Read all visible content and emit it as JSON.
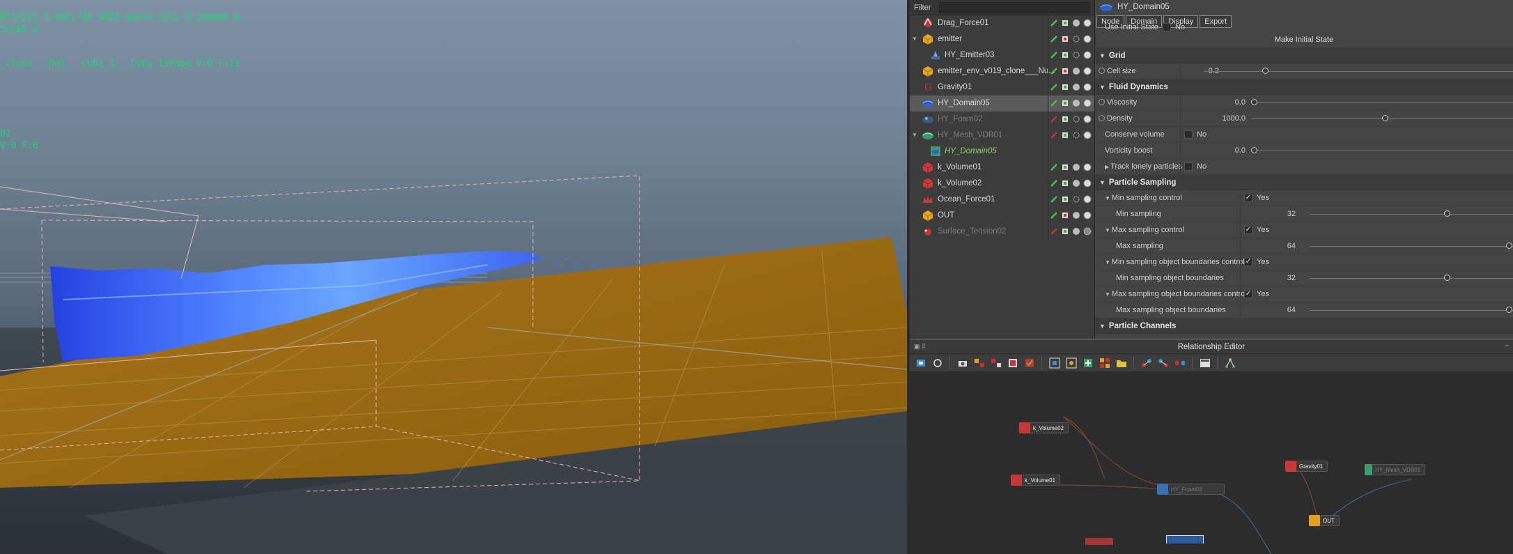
{
  "viewport": {
    "hud_lines": [
      "RTICLES 1,666,745 GRID 0x0x0 CELL 0.200000 m",
      "ICLES 0",
      "_clone___Nul___Cube_1___Cube_1Shape V:0 F:12",
      "02",
      " V:0 F:0"
    ]
  },
  "outliner": {
    "filter_label": "Filter",
    "filter_placeholder": "",
    "items": [
      {
        "label": "Drag_Force01",
        "muted": false
      },
      {
        "label": "emitter",
        "muted": false
      },
      {
        "label": "HY_Emitter03",
        "muted": false
      },
      {
        "label": "emitter_env_v019_clone___Nu...",
        "muted": false
      },
      {
        "label": "Gravity01",
        "muted": false
      },
      {
        "label": "HY_Domain05",
        "muted": false
      },
      {
        "label": "HY_Foam02",
        "muted": true
      },
      {
        "label": "HY_Mesh_VDB01",
        "muted": true
      },
      {
        "label": "HY_Domain05",
        "muted": false
      },
      {
        "label": "k_Volume01",
        "muted": false
      },
      {
        "label": "k_Volume02",
        "muted": false
      },
      {
        "label": "Ocean_Force01",
        "muted": false
      },
      {
        "label": "OUT",
        "muted": false
      },
      {
        "label": "Surface_Tension02",
        "muted": true
      }
    ]
  },
  "attribute_editor": {
    "node_name": "HY_Domain05",
    "tabs": [
      "Node",
      "Domain",
      "Display",
      "Export"
    ],
    "use_initial_state": {
      "label": "Use Initial State",
      "value": "No"
    },
    "make_initial_state": "Make Initial State",
    "sections": {
      "grid": "Grid",
      "fluid_dynamics": "Fluid Dynamics",
      "particle_sampling": "Particle Sampling",
      "particle_channels": "Particle Channels"
    },
    "cell_size": {
      "label": "Cell size",
      "value": "0.2",
      "fraction": 0.19
    },
    "viscosity": {
      "label": "Viscosity",
      "value": "0.0",
      "fraction": 0.0
    },
    "density": {
      "label": "Density",
      "value": "1000.0",
      "fraction": 0.5
    },
    "conserve_volume": {
      "label": "Conserve volume",
      "value": "No"
    },
    "vorticity_boost": {
      "label": "Vorticity boost",
      "value": "0.0",
      "fraction": 0.0
    },
    "track_lonely": {
      "label": "Track lonely particles",
      "value": "No"
    },
    "min_sampling_control": {
      "label": "Min sampling control",
      "value": "Yes"
    },
    "min_sampling": {
      "label": "Min sampling",
      "value": "32",
      "fraction": 0.66
    },
    "max_sampling_control": {
      "label": "Max sampling control",
      "value": "Yes"
    },
    "max_sampling": {
      "label": "Max sampling",
      "value": "64",
      "fraction": 1.0
    },
    "min_obj_control": {
      "label": "Min sampling object boundaries control",
      "value": "Yes"
    },
    "min_obj": {
      "label": "Min sampling object boundaries",
      "value": "32",
      "fraction": 0.66
    },
    "max_obj_control": {
      "label": "Max sampling object boundaries control",
      "value": "Yes"
    },
    "max_obj": {
      "label": "Max sampling object boundaries",
      "value": "64",
      "fraction": 1.0
    }
  },
  "relationship_editor": {
    "title": "Relationship Editor",
    "nodes": [
      {
        "id": "k_vol02",
        "label": "k_Volume02",
        "color": "#c8383a",
        "muted": false
      },
      {
        "id": "k_vol01",
        "label": "k_Volume01",
        "color": "#c8383a",
        "muted": false
      },
      {
        "id": "foam",
        "label": "HY_Foam02",
        "color": "#3a6fb0",
        "muted": true
      },
      {
        "id": "gravity",
        "label": "Gravity01",
        "color": "#c8383a",
        "muted": false
      },
      {
        "id": "mesh",
        "label": "HY_Mesh_VDB01",
        "color": "#3aa06a",
        "muted": true
      },
      {
        "id": "out",
        "label": "OUT",
        "color": "#e0a020",
        "muted": false
      }
    ]
  },
  "colors": {
    "hud_green": "#1cd66f",
    "ground": "#9a6a10",
    "fluid": "#2f5cff",
    "selected_row": "#5b5b5b"
  }
}
